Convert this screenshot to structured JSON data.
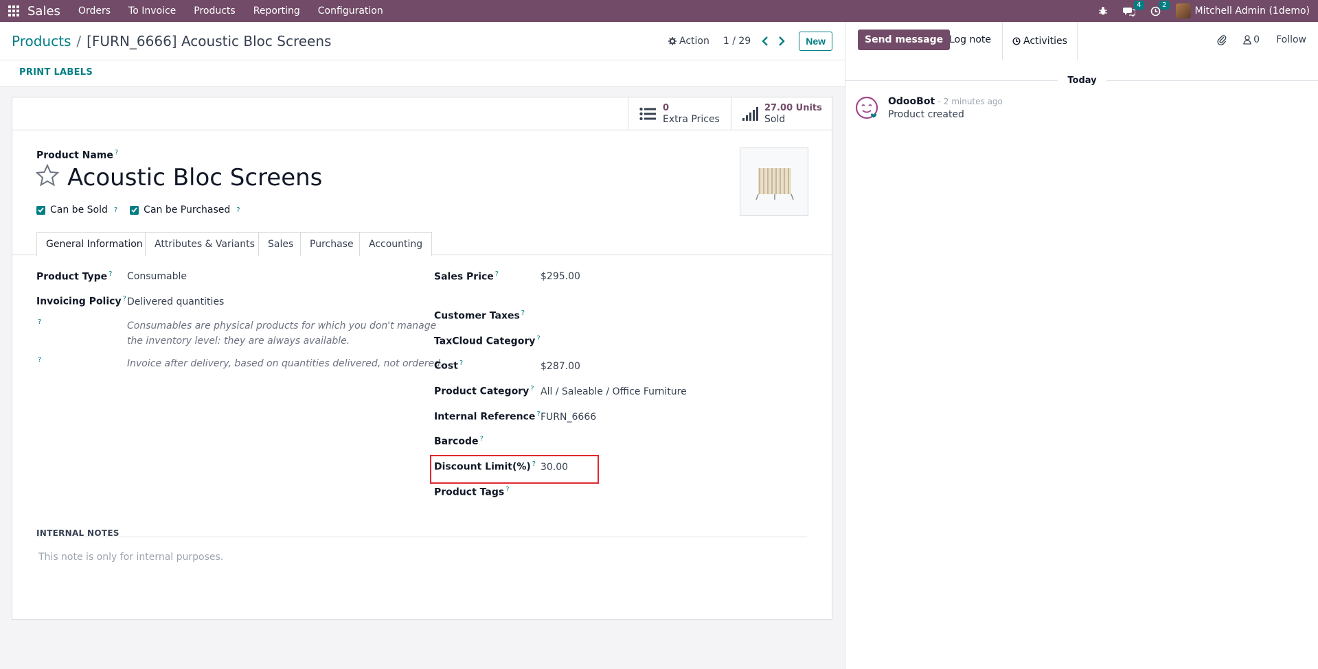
{
  "navbar": {
    "app_name": "Sales",
    "menu": [
      "Orders",
      "To Invoice",
      "Products",
      "Reporting",
      "Configuration"
    ],
    "messages_count": "4",
    "activities_count": "2",
    "user_name": "Mitchell Admin (1demo)"
  },
  "control": {
    "breadcrumb_parent": "Products",
    "breadcrumb_sep": "/",
    "breadcrumb_current": "[FURN_6666] Acoustic Bloc Screens",
    "action_label": "Action",
    "pager": "1 / 29",
    "new_label": "New"
  },
  "statusbar": {
    "print_labels": "PRINT LABELS"
  },
  "stat_buttons": {
    "extra_prices_value": "0",
    "extra_prices_label": "Extra Prices",
    "sold_value": "27.00 Units",
    "sold_label": "Sold"
  },
  "product": {
    "name_label": "Product Name",
    "name": "Acoustic Bloc Screens",
    "can_be_sold": "Can be Sold",
    "can_be_purchased": "Can be Purchased",
    "help_mark": "?"
  },
  "tabs": [
    "General Information",
    "Attributes & Variants",
    "Sales",
    "Purchase",
    "Accounting"
  ],
  "left_fields": {
    "product_type_label": "Product Type",
    "product_type": "Consumable",
    "invoicing_policy_label": "Invoicing Policy",
    "invoicing_policy": "Delivered quantities",
    "note_consumable_1": "Consumables are physical products for which you don't manage",
    "note_consumable_2": "the inventory level: they are always available.",
    "note_invoice": "Invoice after delivery, based on quantities delivered, not ordered."
  },
  "right_fields": {
    "sales_price_label": "Sales Price",
    "sales_price": "$295.00",
    "customer_taxes_label": "Customer Taxes",
    "taxcloud_label": "TaxCloud Category",
    "cost_label": "Cost",
    "cost": "$287.00",
    "category_label": "Product Category",
    "category": "All / Saleable / Office Furniture",
    "internal_ref_label": "Internal Reference",
    "internal_ref": "FURN_6666",
    "barcode_label": "Barcode",
    "discount_label": "Discount Limit(%)",
    "discount": "30.00",
    "tags_label": "Product Tags"
  },
  "notes": {
    "title": "INTERNAL NOTES",
    "placeholder": "This note is only for internal purposes."
  },
  "chatter": {
    "send_message": "Send message",
    "log_note": "Log note",
    "activities": "Activities",
    "followers_count": "0",
    "follow": "Follow",
    "today": "Today",
    "author": "OdooBot",
    "time": "- 2 minutes ago",
    "body": "Product created"
  },
  "colors": {
    "brand": "#714B67",
    "accent": "#017e84",
    "highlight": "#e0282e"
  }
}
